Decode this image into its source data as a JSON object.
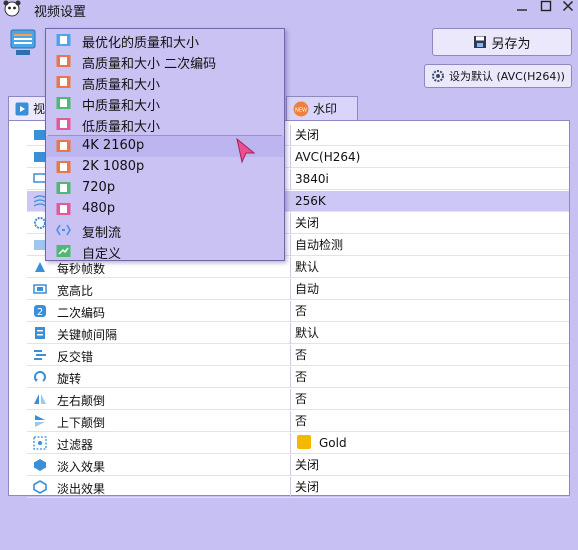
{
  "window": {
    "title": "视频设置"
  },
  "buttons": {
    "save_as": "另存为",
    "set_default": "设为默认 (AVC(H264))"
  },
  "tabs": [
    {
      "label": "视"
    },
    {
      "label": "水印"
    }
  ],
  "dropdown": {
    "items": [
      {
        "label": "最优化的质量和大小",
        "color": "#4aa6e6"
      },
      {
        "label": "高质量和大小 二次编码",
        "color": "#e8784c"
      },
      {
        "label": "高质量和大小",
        "color": "#e8784c"
      },
      {
        "label": "中质量和大小",
        "color": "#4fb877"
      },
      {
        "label": "低质量和大小",
        "color": "#e35a9b"
      },
      {
        "label": "4K 2160p",
        "color": "#e8784c"
      },
      {
        "label": "2K 1080p",
        "color": "#e8784c"
      },
      {
        "label": "720p",
        "color": "#4fb877"
      },
      {
        "label": "480p",
        "color": "#e35a9b"
      },
      {
        "label": "复制流",
        "color": "#4a8fe8"
      },
      {
        "label": "自定义",
        "color": "#4fb877"
      }
    ]
  },
  "rows": [
    {
      "label": "",
      "value": "关闭"
    },
    {
      "label": "",
      "value": "AVC(H264)"
    },
    {
      "label": "",
      "value": "3840i"
    },
    {
      "label": "",
      "value": "256K"
    },
    {
      "label": "",
      "value": "关闭"
    },
    {
      "label": "",
      "value": "自动检测"
    },
    {
      "label": "每秒帧数",
      "value": "默认"
    },
    {
      "label": "宽高比",
      "value": "自动"
    },
    {
      "label": "二次编码",
      "value": "否"
    },
    {
      "label": "关键帧间隔",
      "value": "默认"
    },
    {
      "label": "反交错",
      "value": "否"
    },
    {
      "label": "旋转",
      "value": "否"
    },
    {
      "label": "左右颠倒",
      "value": "否"
    },
    {
      "label": "上下颠倒",
      "value": "否"
    },
    {
      "label": "过滤器",
      "value": "Gold"
    },
    {
      "label": "淡入效果",
      "value": "关闭"
    },
    {
      "label": "淡出效果",
      "value": "关闭"
    }
  ],
  "colors": {
    "accent": "#c7c0f2",
    "highlight": "#cdc7f6",
    "gold": "#f5b800"
  }
}
